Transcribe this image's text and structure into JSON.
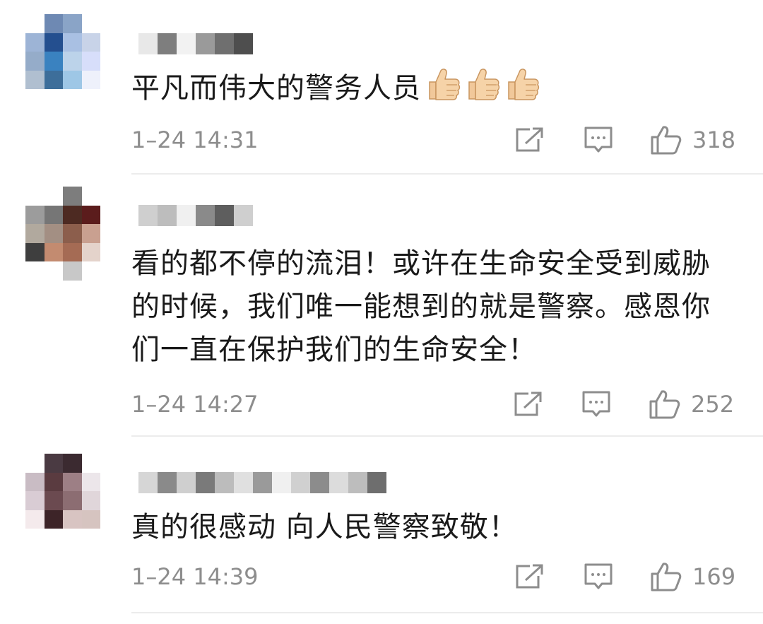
{
  "comments": [
    {
      "text": "平凡而伟大的警务人员",
      "emoji_icon": "thumbs-up-emoji",
      "emoji_count": 3,
      "time": "1–24 14:31",
      "likes": "318",
      "avatar_colors": [
        "#ffffff",
        "#6e89b3",
        "#8aa4c7",
        "#ffffff",
        "#9db4d6",
        "#244f8f",
        "#a9c0e3",
        "#c8d3e8",
        "#95acc9",
        "#3a82c0",
        "#bcd3ea",
        "#d7defa",
        "#b0bfd0",
        "#3d6e9a",
        "#9ec7e6",
        "#eef1fb"
      ],
      "name_blur": [
        "#e8e8e8",
        "#7e7e7e",
        "#f2f2f2",
        "#9a9a9a",
        "#6f6f6f",
        "#4e4e4e"
      ]
    },
    {
      "text": "看的都不停的流泪！或许在生命安全受到威胁的时候，我们唯一能想到的就是警察。感恩你们一直在保护我们的生命安全！",
      "time": "1–24 14:27",
      "likes": "252",
      "avatar_colors": [
        "#ffffff",
        "#ffffff",
        "#7d7d7d",
        "#ffffff",
        "#9c9c9c",
        "#767676",
        "#4d2a22",
        "#5b1c1c",
        "#b1a99e",
        "#a38f83",
        "#8c5e4c",
        "#c9a090",
        "#3e3e3e",
        "#c38b70",
        "#a56b54",
        "#e4d3cb",
        "#ffffff",
        "#ffffff",
        "#c8c8c8",
        "#ffffff"
      ],
      "name_blur": [
        "#cfcfcf",
        "#bdbdbd",
        "#f0f0f0",
        "#8a8a8a",
        "#5e5e5e",
        "#cfcfcf"
      ]
    },
    {
      "text": "真的很感动 向人民警察致敬！",
      "time": "1–24 14:39",
      "likes": "169",
      "avatar_colors": [
        "#ffffff",
        "#4a3a42",
        "#3b2a30",
        "#ffffff",
        "#c9bcc4",
        "#5a3b40",
        "#9d7f85",
        "#ece6ea",
        "#d9ccd4",
        "#6b4a50",
        "#8c6d72",
        "#e0d6da",
        "#f4eaec",
        "#3d2428",
        "#d8c4c2",
        "#d6c4c0"
      ],
      "name_blur": [
        "#d6d6d6",
        "#8a8a8a",
        "#cfcfcf",
        "#7a7a7a",
        "#bcbcbc",
        "#e0e0e0",
        "#9a9a9a",
        "#f0f0f0",
        "#d0d0d0",
        "#8c8c8c",
        "#dcdcdc",
        "#bdbdbd",
        "#6e6e6e"
      ]
    }
  ],
  "actions": {
    "share_icon": "share-icon",
    "reply_icon": "comment-icon",
    "like_icon": "thumbs-up-icon"
  }
}
